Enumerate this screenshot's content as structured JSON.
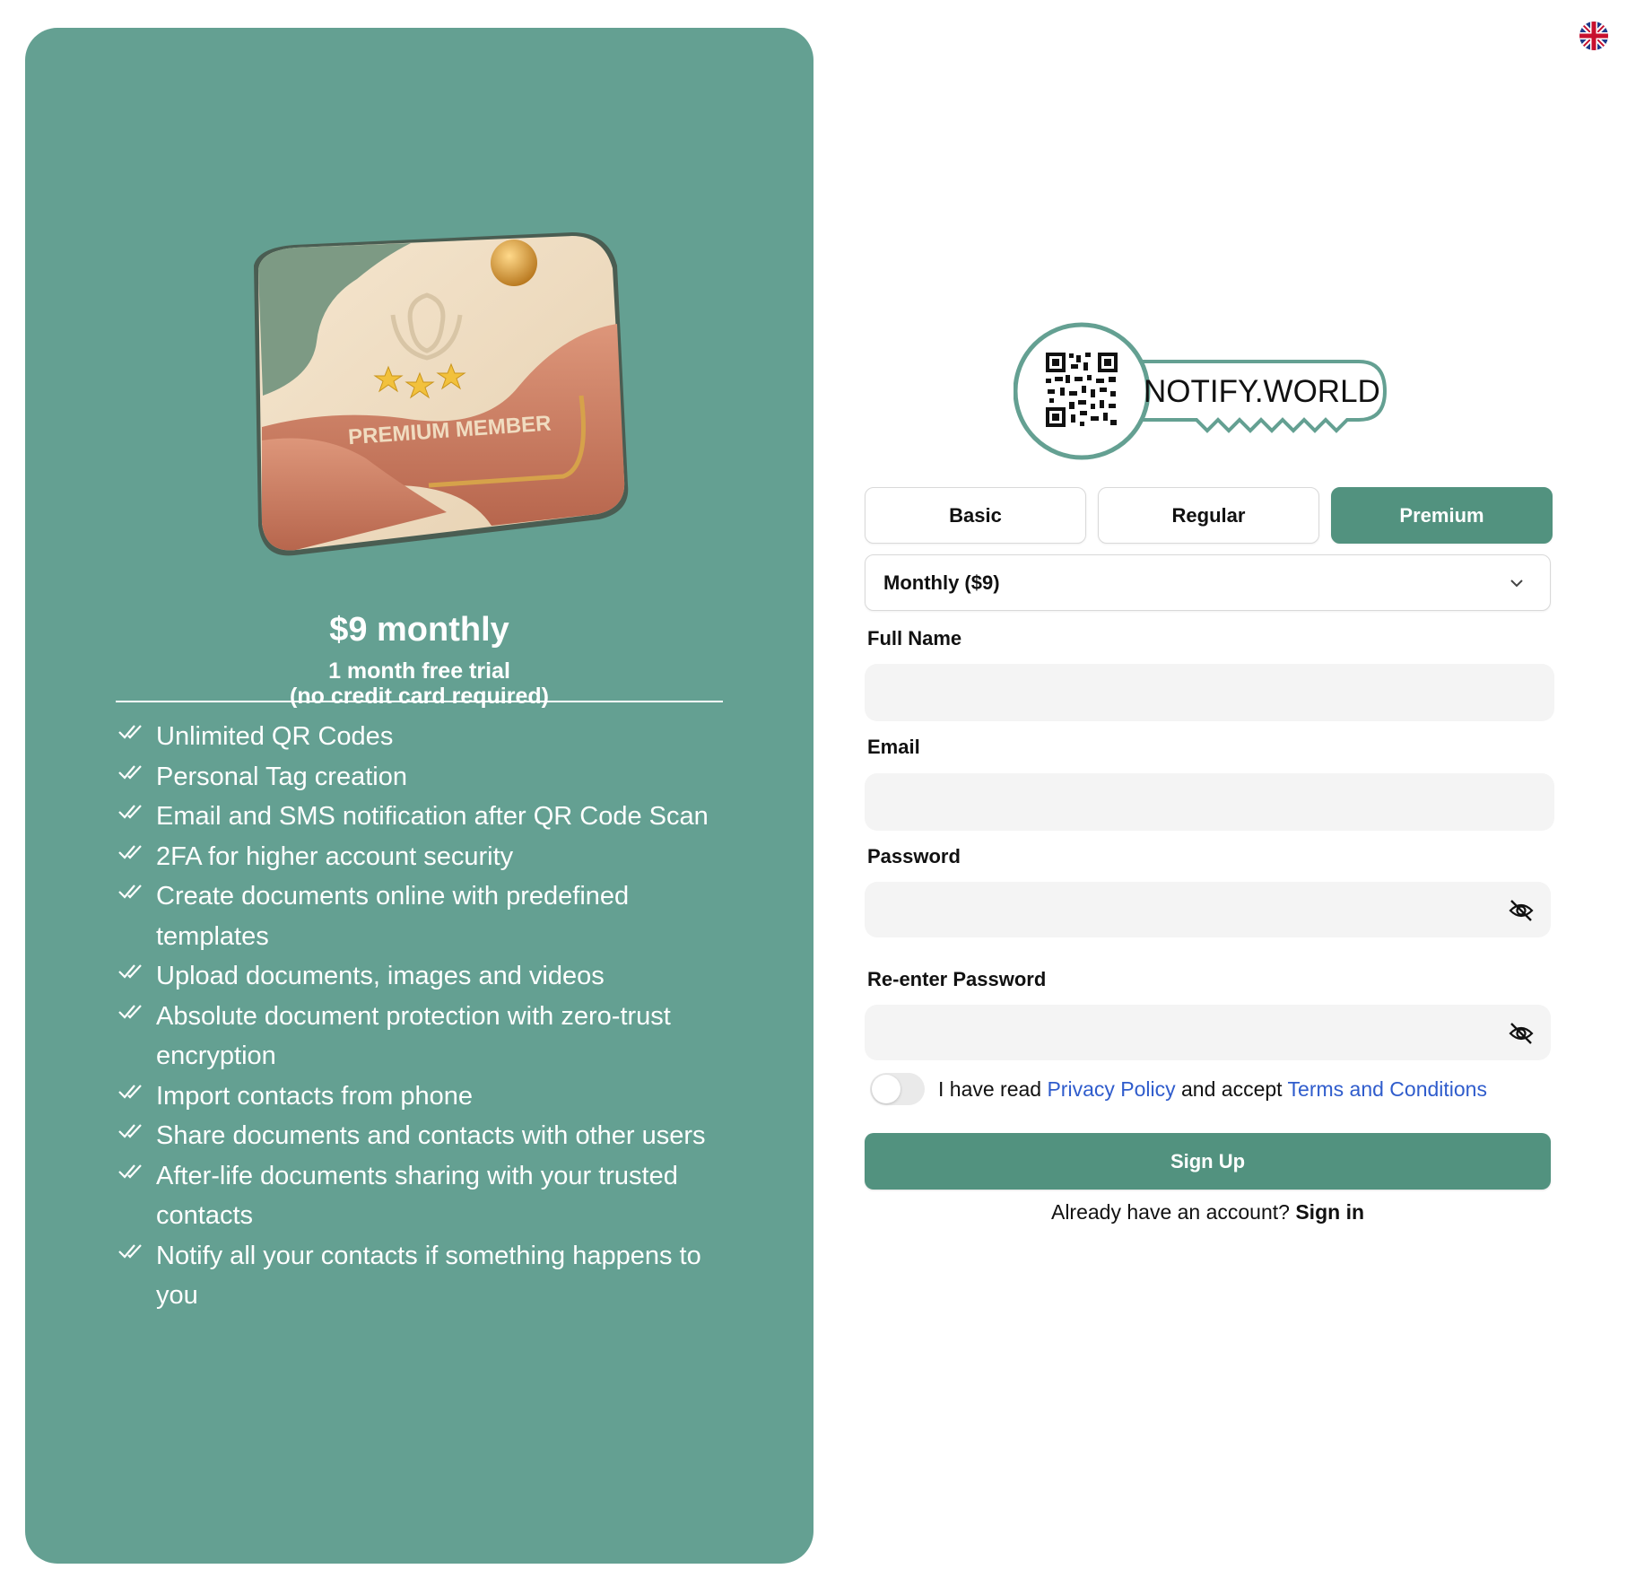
{
  "plan_card": {
    "price": "$9 monthly",
    "trial_line1": "1 month free trial",
    "trial_line2": "(no credit card required)",
    "card_text": "PREMIUM MEMBER",
    "features": [
      "Unlimited QR Codes",
      "Personal Tag creation",
      "Email and SMS notification after QR Code Scan",
      "2FA for higher account security",
      "Create documents online with predefined templates",
      "Upload documents, images and videos",
      "Absolute document protection with zero-trust encryption",
      "Import contacts from phone",
      "Share documents and contacts with other users",
      "After-life documents sharing with your trusted contacts",
      "Notify all your contacts if something happens to you"
    ]
  },
  "header": {
    "language_icon": "uk-flag-icon"
  },
  "logo": {
    "text": "NOTIFY.WORLD"
  },
  "tabs": [
    {
      "label": "Basic",
      "active": false
    },
    {
      "label": "Regular",
      "active": false
    },
    {
      "label": "Premium",
      "active": true
    }
  ],
  "billing": {
    "selected": "Monthly ($9)"
  },
  "form": {
    "full_name_label": "Full Name",
    "full_name_value": "",
    "email_label": "Email",
    "email_value": "",
    "password_label": "Password",
    "password_value": "",
    "repassword_label": "Re-enter Password",
    "repassword_value": ""
  },
  "consent": {
    "prefix": "I have read ",
    "privacy_link": "Privacy Policy",
    "middle": " and accept ",
    "terms_link": "Terms and Conditions",
    "checked": false
  },
  "actions": {
    "signup_label": "Sign Up",
    "have_account": "Already have an account? ",
    "signin_label": "Sign in"
  },
  "colors": {
    "panel": "#64a092",
    "primary": "#52927f",
    "link": "#2f5ccc"
  }
}
